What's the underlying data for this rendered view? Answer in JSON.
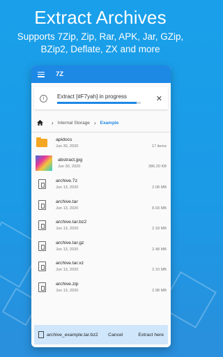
{
  "promo": {
    "title": "Extract Archives",
    "subtitle": "Supports 7Zip, Zip, Rar, APK, Jar, GZip, BZip2, Deflate, ZX and more"
  },
  "appbar": {
    "title": "7Z"
  },
  "progress": {
    "text": "Extract [#F7yah] in progress",
    "fraction": 0.95
  },
  "breadcrumb": {
    "parent": "Internal Storage",
    "current": "Example"
  },
  "files": [
    {
      "name": "apidocs",
      "date": "Jun 30, 2020",
      "size": "17 items",
      "icon": "folder-icon"
    },
    {
      "name": "abstract.jpg",
      "date": "Jun 30, 2020",
      "size": "386.20 KB",
      "icon": "image-thumbnail"
    },
    {
      "name": "archive.7z",
      "date": "Jun 13, 2020",
      "size": "2.08 MB",
      "icon": "archive-icon"
    },
    {
      "name": "archive.tar",
      "date": "Jun 13, 2020",
      "size": "8.93 MB",
      "icon": "archive-icon"
    },
    {
      "name": "archive.tar.bz2",
      "date": "Jun 13, 2020",
      "size": "2.18 MB",
      "icon": "archive-icon"
    },
    {
      "name": "archive.tar.gz",
      "date": "Jun 13, 2020",
      "size": "2.48 MB",
      "icon": "archive-icon"
    },
    {
      "name": "archive.tar.xz",
      "date": "Jun 13, 2020",
      "size": "2.10 MB",
      "icon": "archive-icon"
    },
    {
      "name": "archive.zip",
      "date": "Jun 13, 2020",
      "size": "2.98 MB",
      "icon": "archive-icon"
    }
  ],
  "bottom_bar": {
    "file": "archive_example.tar.bz2",
    "cancel": "Cancel",
    "extract": "Extract here"
  },
  "colors": {
    "accent": "#1e88e5",
    "background": "#1b9ae6",
    "folder": "#f5a623"
  }
}
